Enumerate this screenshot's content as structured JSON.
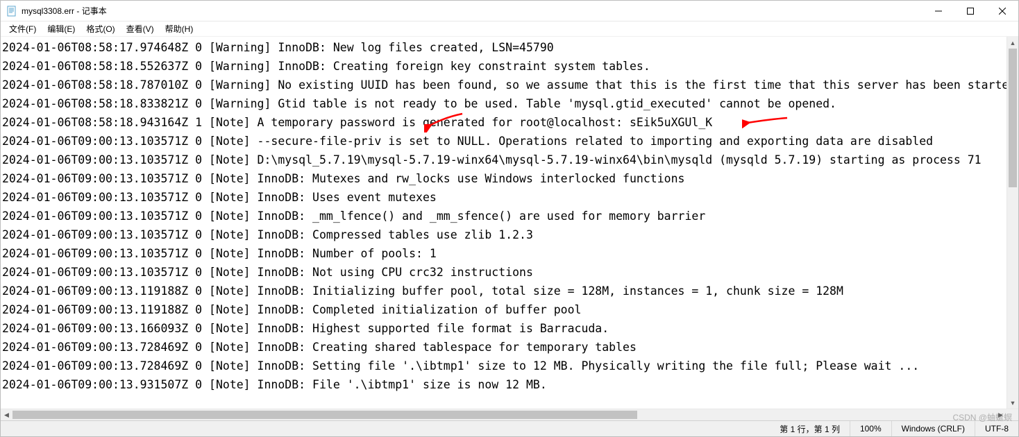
{
  "window": {
    "title": "mysql3308.err - 记事本"
  },
  "menu": {
    "file": "文件(F)",
    "edit": "编辑(E)",
    "format": "格式(O)",
    "view": "查看(V)",
    "help": "帮助(H)"
  },
  "log_lines": [
    "2024-01-06T08:58:17.974648Z 0 [Warning] InnoDB: New log files created, LSN=45790",
    "2024-01-06T08:58:18.552637Z 0 [Warning] InnoDB: Creating foreign key constraint system tables.",
    "2024-01-06T08:58:18.787010Z 0 [Warning] No existing UUID has been found, so we assume that this is the first time that this server has been started. G",
    "2024-01-06T08:58:18.833821Z 0 [Warning] Gtid table is not ready to be used. Table 'mysql.gtid_executed' cannot be opened.",
    "2024-01-06T08:58:18.943164Z 1 [Note] A temporary password is generated for root@localhost: sEik5uXGUl_K",
    "2024-01-06T09:00:13.103571Z 0 [Note] --secure-file-priv is set to NULL. Operations related to importing and exporting data are disabled",
    "2024-01-06T09:00:13.103571Z 0 [Note] D:\\mysql_5.7.19\\mysql-5.7.19-winx64\\mysql-5.7.19-winx64\\bin\\mysqld (mysqld 5.7.19) starting as process 71",
    "2024-01-06T09:00:13.103571Z 0 [Note] InnoDB: Mutexes and rw_locks use Windows interlocked functions",
    "2024-01-06T09:00:13.103571Z 0 [Note] InnoDB: Uses event mutexes",
    "2024-01-06T09:00:13.103571Z 0 [Note] InnoDB: _mm_lfence() and _mm_sfence() are used for memory barrier",
    "2024-01-06T09:00:13.103571Z 0 [Note] InnoDB: Compressed tables use zlib 1.2.3",
    "2024-01-06T09:00:13.103571Z 0 [Note] InnoDB: Number of pools: 1",
    "2024-01-06T09:00:13.103571Z 0 [Note] InnoDB: Not using CPU crc32 instructions",
    "2024-01-06T09:00:13.119188Z 0 [Note] InnoDB: Initializing buffer pool, total size = 128M, instances = 1, chunk size = 128M",
    "2024-01-06T09:00:13.119188Z 0 [Note] InnoDB: Completed initialization of buffer pool",
    "2024-01-06T09:00:13.166093Z 0 [Note] InnoDB: Highest supported file format is Barracuda.",
    "2024-01-06T09:00:13.728469Z 0 [Note] InnoDB: Creating shared tablespace for temporary tables",
    "2024-01-06T09:00:13.728469Z 0 [Note] InnoDB: Setting file '.\\ibtmp1' size to 12 MB. Physically writing the file full; Please wait ...",
    "2024-01-06T09:00:13.931507Z 0 [Note] InnoDB: File '.\\ibtmp1' size is now 12 MB."
  ],
  "status": {
    "position": "第 1 行，第 1 列",
    "zoom": "100%",
    "line_ending": "Windows (CRLF)",
    "encoding": "UTF-8"
  },
  "watermark": "CSDN @蚰蜒螟",
  "annotation_color": "#ff0000"
}
